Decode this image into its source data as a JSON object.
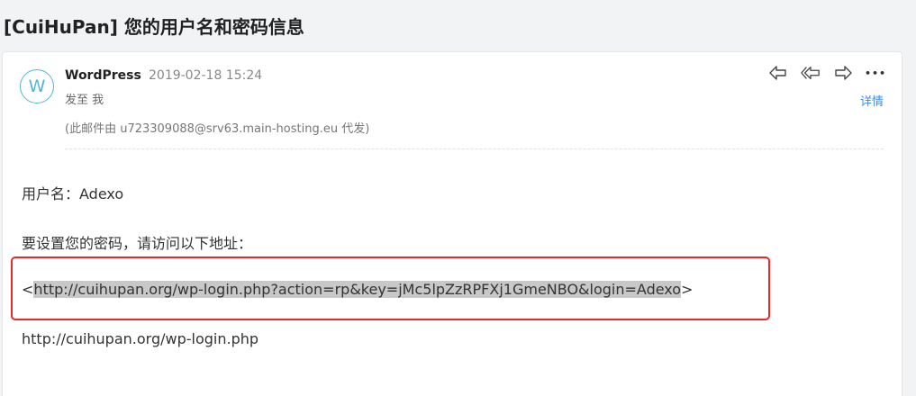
{
  "subject": "[CuiHuPan] 您的用户名和密码信息",
  "sender": {
    "avatar_letter": "W",
    "name": "WordPress",
    "time": "2019-02-18 15:24",
    "to": "发至 我",
    "via": "(此邮件由 u723309088@srv63.main-hosting.eu 代发)"
  },
  "actions": {
    "reply": "reply-icon",
    "reply_all": "reply-all-icon",
    "forward": "forward-icon",
    "more": "•••",
    "details": "详情"
  },
  "body": {
    "username_line": "用户名：Adexo",
    "instruction_line": "要设置您的密码，请访问以下地址：",
    "reset_link_open": "<",
    "reset_link": "http://cuihupan.org/wp-login.php?action=rp&key=jMc5lpZzRPFXj1GmeNBO&login=Adexo",
    "reset_link_close": ">",
    "login_url": "http://cuihupan.org/wp-login.php"
  },
  "colors": {
    "accent": "#3a8ee6",
    "avatar": "#52b6d8",
    "highlight": "#e52a2a"
  }
}
